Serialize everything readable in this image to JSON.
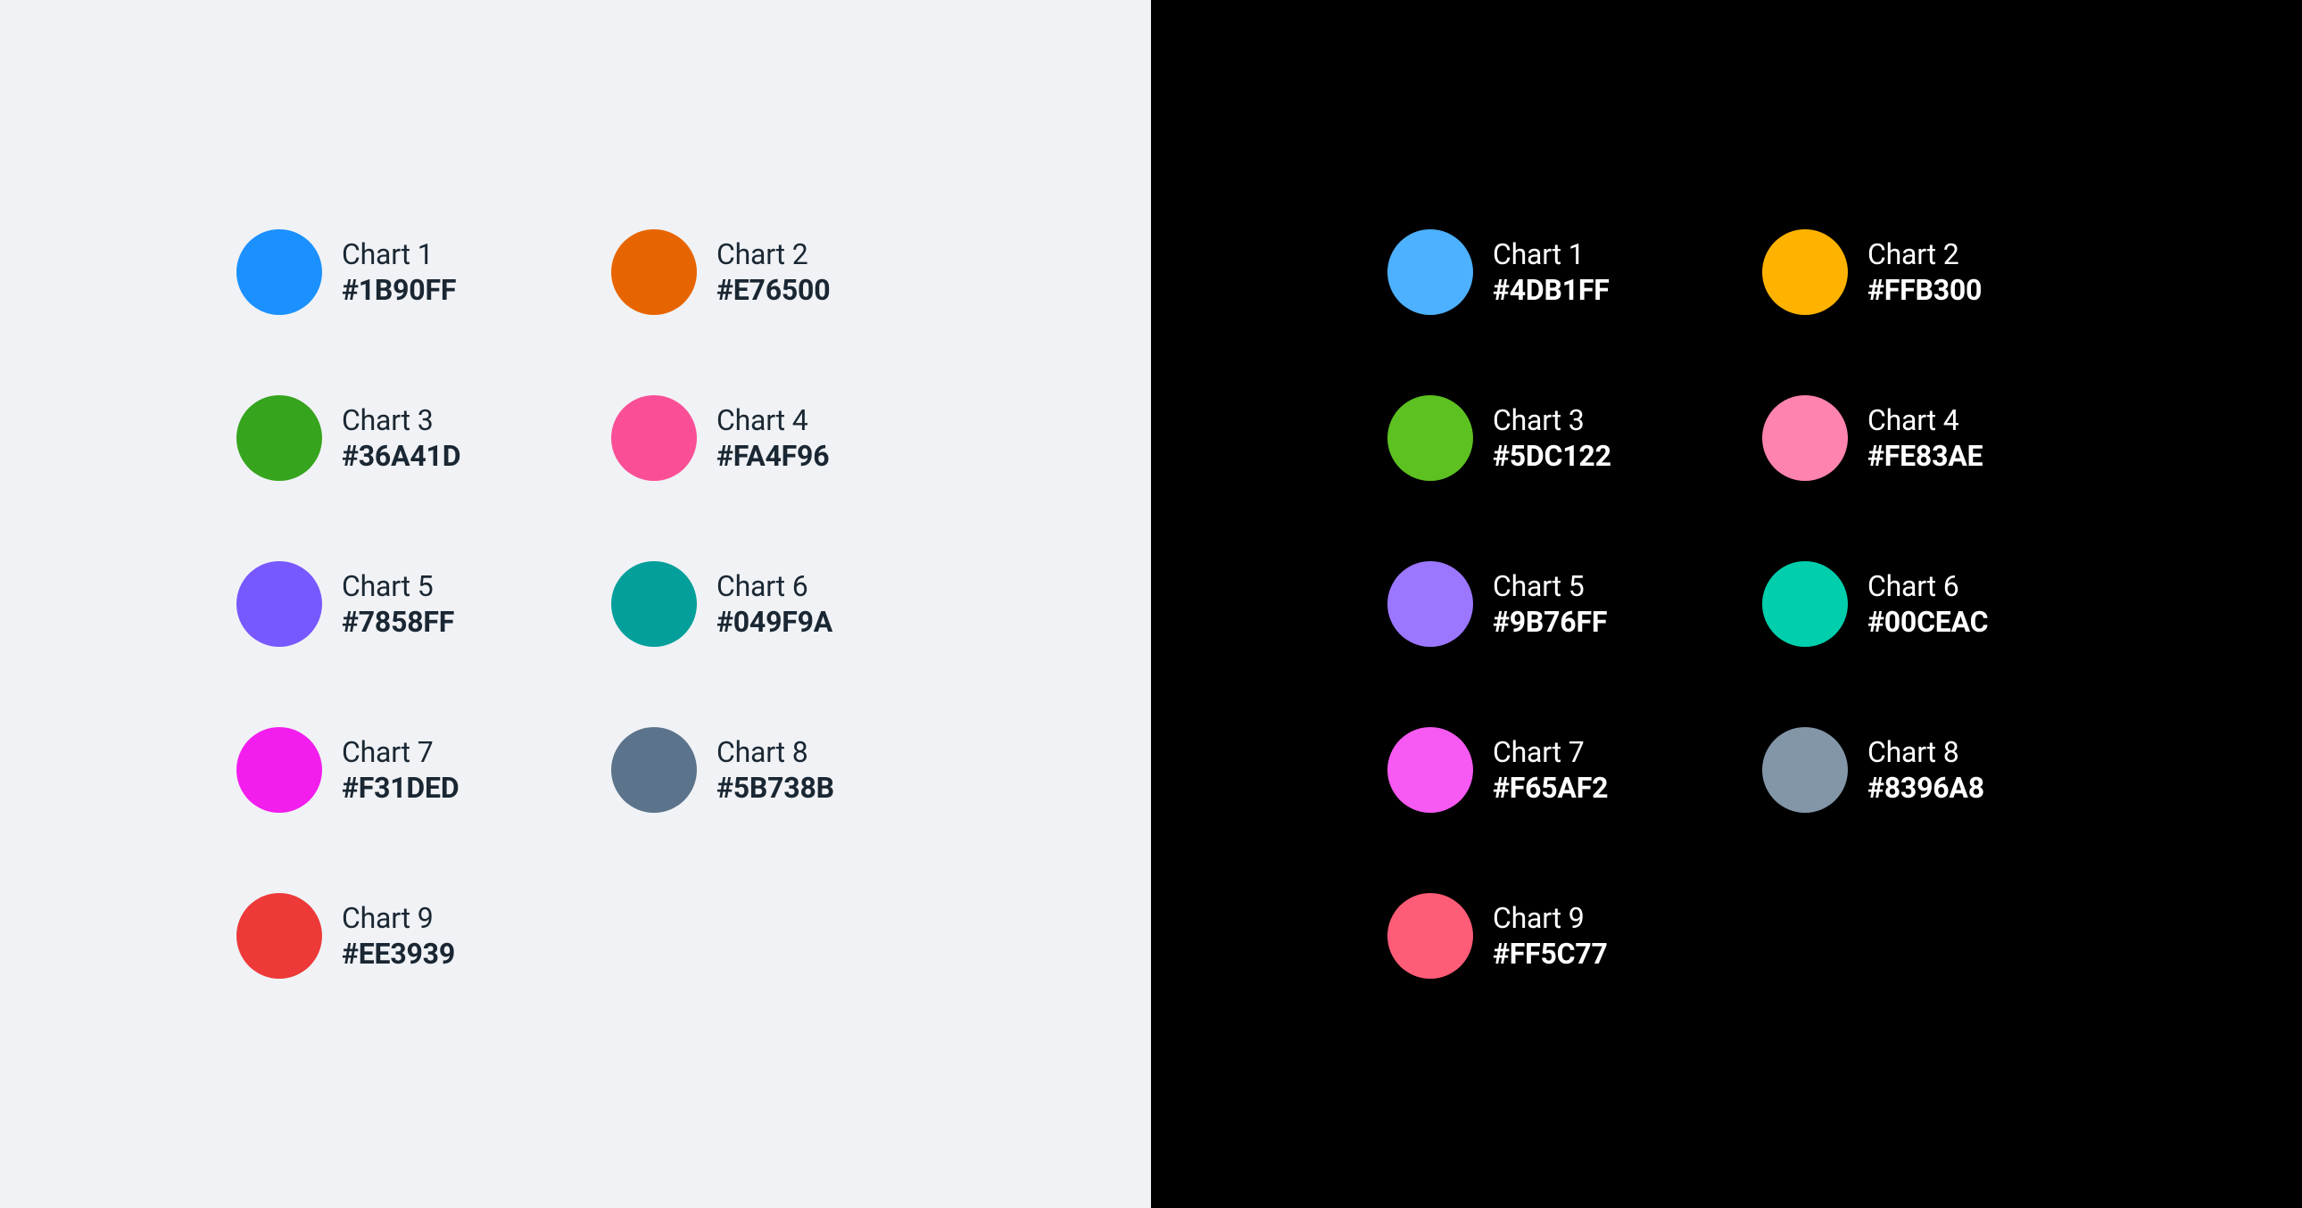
{
  "light": {
    "swatches": [
      {
        "label": "Chart 1",
        "hex": "#1B90FF"
      },
      {
        "label": "Chart 2",
        "hex": "#E76500"
      },
      {
        "label": "Chart 3",
        "hex": "#36A41D"
      },
      {
        "label": "Chart 4",
        "hex": "#FA4F96"
      },
      {
        "label": "Chart 5",
        "hex": "#7858FF"
      },
      {
        "label": "Chart 6",
        "hex": "#049F9A"
      },
      {
        "label": "Chart 7",
        "hex": "#F31DED"
      },
      {
        "label": "Chart 8",
        "hex": "#5B738B"
      },
      {
        "label": "Chart 9",
        "hex": "#EE3939"
      }
    ]
  },
  "dark": {
    "swatches": [
      {
        "label": "Chart 1",
        "hex": "#4DB1FF"
      },
      {
        "label": "Chart 2",
        "hex": "#FFB300"
      },
      {
        "label": "Chart 3",
        "hex": "#5DC122"
      },
      {
        "label": "Chart 4",
        "hex": "#FE83AE"
      },
      {
        "label": "Chart 5",
        "hex": "#9B76FF"
      },
      {
        "label": "Chart 6",
        "hex": "#00CEAC"
      },
      {
        "label": "Chart 7",
        "hex": "#F65AF2"
      },
      {
        "label": "Chart 8",
        "hex": "#8396A8"
      },
      {
        "label": "Chart 9",
        "hex": "#FF5C77"
      }
    ]
  }
}
